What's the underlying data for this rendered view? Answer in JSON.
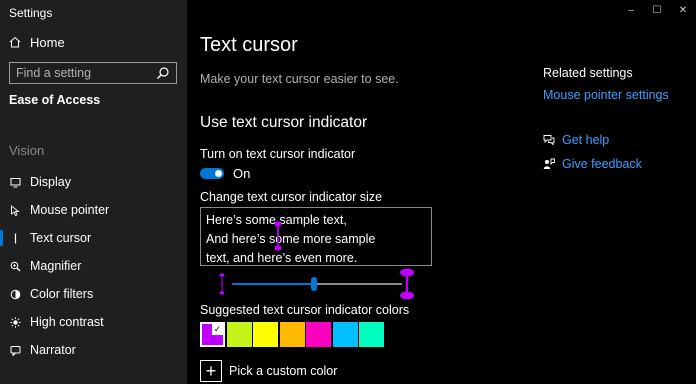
{
  "app": {
    "title": "Settings"
  },
  "sidebar": {
    "home_label": "Home",
    "search_placeholder": "Find a setting",
    "section_title": "Ease of Access",
    "group_label": "Vision",
    "items": [
      {
        "label": "Display",
        "icon": "display-icon"
      },
      {
        "label": "Mouse pointer",
        "icon": "mouse-pointer-icon"
      },
      {
        "label": "Text cursor",
        "icon": "text-cursor-icon",
        "selected": true
      },
      {
        "label": "Magnifier",
        "icon": "magnifier-icon"
      },
      {
        "label": "Color filters",
        "icon": "color-filters-icon"
      },
      {
        "label": "High contrast",
        "icon": "high-contrast-icon"
      },
      {
        "label": "Narrator",
        "icon": "narrator-icon"
      }
    ]
  },
  "window_controls": {
    "minimize": "–",
    "maximize": "☐",
    "close": "✕"
  },
  "main": {
    "title": "Text cursor",
    "subtitle": "Make your text cursor easier to see.",
    "indicator_heading": "Use text cursor indicator",
    "toggle_label": "Turn on text cursor indicator",
    "toggle_state": "On",
    "size_label": "Change text cursor indicator size",
    "sample_lines": [
      "Here’s some sample text,",
      "And here’s some more sample",
      "text, and here’s even more."
    ],
    "size_level": 0.48,
    "colors_label": "Suggested text cursor indicator colors",
    "colors": [
      "#bf00ff",
      "#c6f31a",
      "#ffff00",
      "#ffb900",
      "#ff00bf",
      "#00bfff",
      "#00ffbf"
    ],
    "selected_color_index": 0,
    "custom_color_label": "Pick a custom color"
  },
  "related": {
    "title": "Related settings",
    "link": "Mouse pointer settings",
    "get_help": "Get help",
    "give_feedback": "Give feedback"
  },
  "accent_color": "#0078d7",
  "link_color": "#3aa0ff"
}
